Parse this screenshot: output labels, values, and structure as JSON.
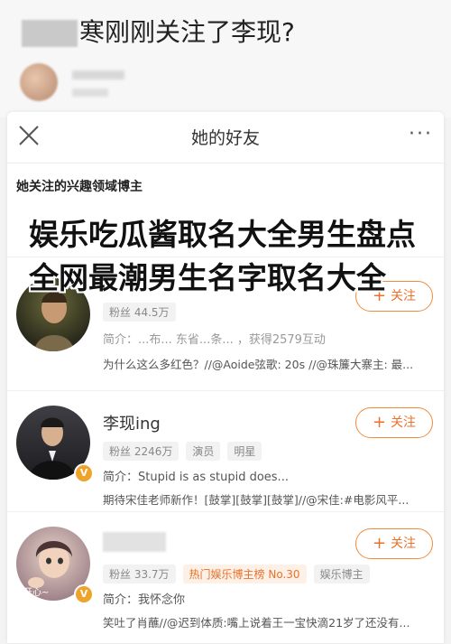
{
  "header_post": {
    "title_suffix": "寒刚刚关注了李现?"
  },
  "panel": {
    "title": "她的好友",
    "more_label": "···",
    "section_title": "她关注的兴趣领域博主"
  },
  "overlay_title": "娱乐吃瓜酱取名大全男生盘点全网最潮男生名字取名大全",
  "accounts": [
    {
      "name": "",
      "fans": "粉丝 44.5万",
      "bio": "简介：...布... 东省...条... ，获得2579互动",
      "recent": "为什么这么多红色？//@Aoide弦歌: 20s //@珠簾大寨主: 最...",
      "follow_label": "关注"
    },
    {
      "name": "李现ing",
      "fans": "粉丝 2246万",
      "tags": [
        "演员",
        "明星"
      ],
      "bio": "简介：Stupid is as stupid does...",
      "recent": "期待宋佳老师新作！[鼓掌][鼓掌][鼓掌]//@宋佳:#电影风平...",
      "follow_label": "关注"
    },
    {
      "name": "",
      "fans": "粉丝 33.7万",
      "tags": [
        "热门娱乐博主榜 No.30",
        "娱乐博主"
      ],
      "bio": "简介：我怀念你",
      "recent": "笑吐了肖蘸//@迟到体质:嘴上说着王一宝快滴21岁了还没有...",
      "follow_label": "关注",
      "avatar_text": "开心~"
    }
  ],
  "colors": {
    "accent": "#e8722c",
    "badge": "#f0a32a"
  }
}
